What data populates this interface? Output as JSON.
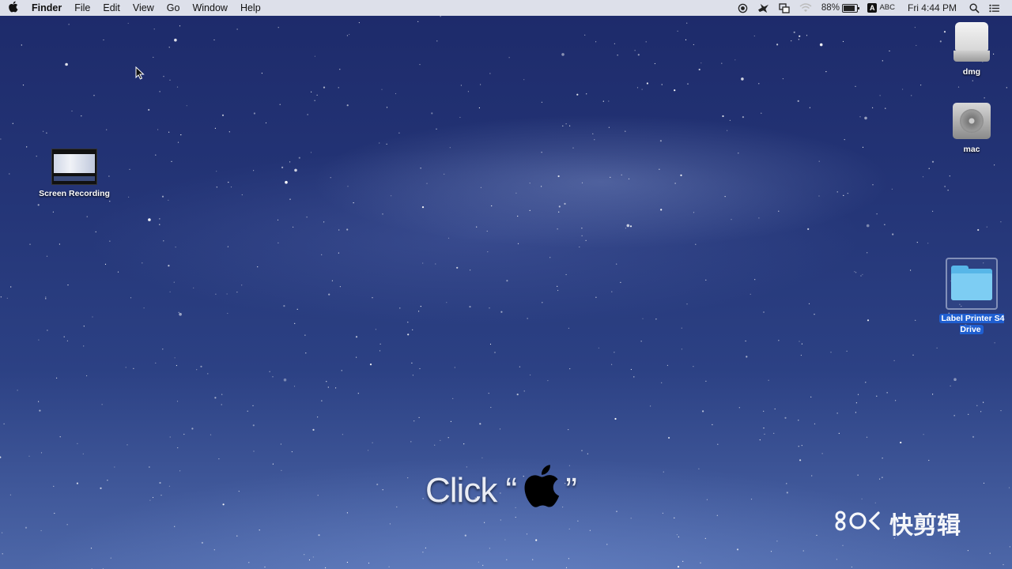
{
  "menubar": {
    "app_name": "Finder",
    "menus": [
      "File",
      "Edit",
      "View",
      "Go",
      "Window",
      "Help"
    ],
    "status": {
      "battery_percent": "88%",
      "battery_level": 0.88,
      "input_badge": "A",
      "input_label": "ABC",
      "clock": "Fri 4:44 PM"
    },
    "icons": [
      "apple-icon",
      "record-icon",
      "bird-icon",
      "mirror-icon",
      "wifi-icon",
      "battery-icon",
      "spotlight-icon",
      "notification-icon"
    ]
  },
  "desktop": {
    "icons": [
      {
        "name": "dmg",
        "type": "drive"
      },
      {
        "name": "mac",
        "type": "hard-disk"
      },
      {
        "name": "Label Printer S4 Drive",
        "type": "folder",
        "selected": true
      },
      {
        "name": "Screen Recording",
        "type": "video-thumbnail"
      }
    ]
  },
  "caption": {
    "prefix": "Click “",
    "suffix": "”"
  },
  "watermark": {
    "logo": "бO‹",
    "text": "快剪辑"
  }
}
